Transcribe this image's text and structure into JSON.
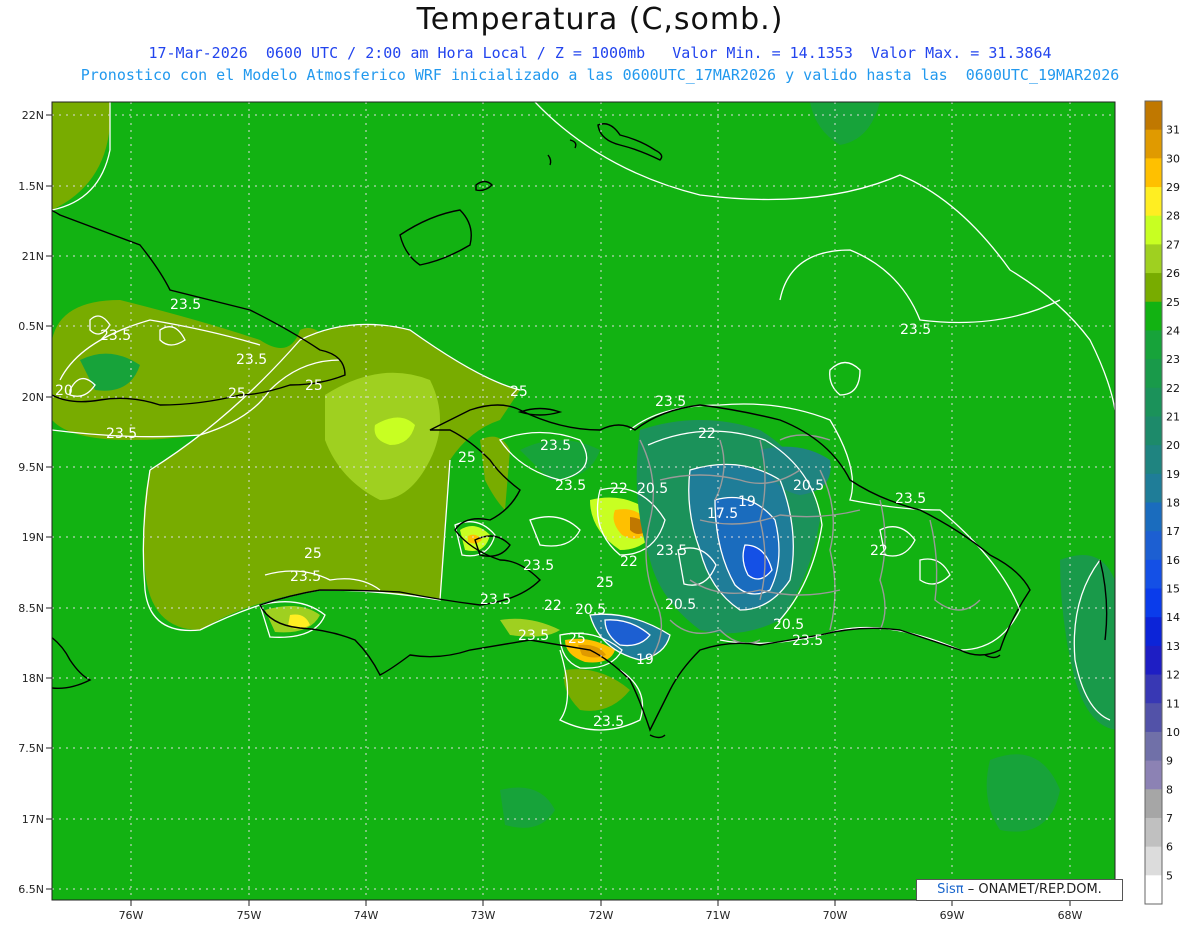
{
  "header": {
    "title": "Temperatura (C,somb.)",
    "info_line": "17-Mar-2026  0600 UTC / 2:00 am Hora Local / Z = 1000mb   Valor Min. = 14.1353  Valor Max. = 31.3864",
    "forecast_line": "Pronostico con el Modelo Atmosferico WRF inicializado a las 0600UTC_17MAR2026 y valido hasta las  0600UTC_19MAR2026"
  },
  "axes": {
    "latitudes": [
      "22N",
      "1.5N",
      "21N",
      "0.5N",
      "20N",
      "9.5N",
      "19N",
      "8.5N",
      "18N",
      "7.5N",
      "17N",
      "6.5N"
    ],
    "longitudes": [
      "76W",
      "75W",
      "74W",
      "73W",
      "72W",
      "71W",
      "70W",
      "69W",
      "68W"
    ]
  },
  "colorbar": {
    "ticks": [
      "31",
      "30",
      "29",
      "28",
      "27",
      "26",
      "25",
      "24",
      "23",
      "22",
      "21",
      "20",
      "19",
      "18",
      "17",
      "16",
      "15",
      "14",
      "13",
      "12",
      "11",
      "10",
      "9",
      "8",
      "7",
      "6",
      "5"
    ],
    "colors": [
      "#c07800",
      "#e09a00",
      "#ffc000",
      "#ffee22",
      "#c8ff22",
      "#9fd020",
      "#78ac00",
      "#12b212",
      "#17a33a",
      "#199a4a",
      "#1b925a",
      "#1d8a6a",
      "#1f8480",
      "#1f7d98",
      "#1a6cbe",
      "#1c5fd2",
      "#1450e6",
      "#0a3ceb",
      "#0c24d8",
      "#1e1ec4",
      "#3838b4",
      "#5252a8",
      "#7070a8",
      "#8c82b4",
      "#a6a6a6",
      "#c0c0c0",
      "#dcdcdc",
      "#ffffff"
    ]
  },
  "contour_labels": [
    "23.5",
    "23.5",
    "23.5",
    "23.5",
    "25",
    "25",
    "20",
    "23.5",
    "23.5",
    "25",
    "25",
    "25",
    "25",
    "23.5",
    "23.5",
    "23.5",
    "22",
    "22",
    "20.5",
    "20.5",
    "19",
    "17.5",
    "23.5",
    "23.5",
    "22",
    "23.5",
    "22",
    "20.5",
    "20.5",
    "20.5",
    "19",
    "23.5",
    "23.5",
    "23.5",
    "22",
    "25",
    "23.5"
  ],
  "credit": {
    "brand": "Sisπ",
    "text": "– ONAMET/REP.DOM."
  }
}
